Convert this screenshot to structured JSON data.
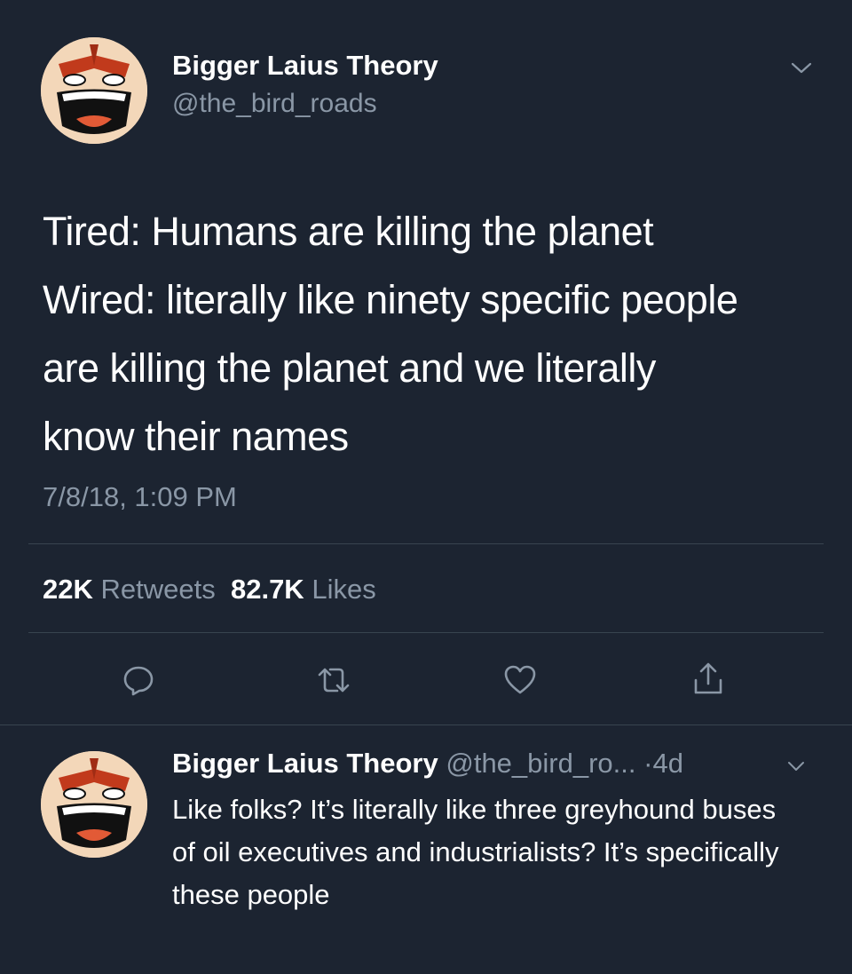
{
  "tweet": {
    "display_name": "Bigger Laius Theory",
    "handle": "@the_bird_roads",
    "lines": [
      "Tired: Humans are killing the planet",
      "Wired: literally like ninety specific people",
      "are killing the planet and we literally",
      "know their names"
    ],
    "timestamp": "7/8/18, 1:09 PM",
    "retweets_count": "22K",
    "retweets_label": "Retweets",
    "likes_count": "82.7K",
    "likes_label": "Likes"
  },
  "reply": {
    "display_name": "Bigger Laius Theory",
    "handle": "@the_bird_ro...",
    "separator": "·",
    "age": "4d",
    "text": "Like folks? It’s literally like three greyhound buses of oil executives and industrialists? It’s specifically these people"
  },
  "icons": {
    "chevron": "chevron-down-icon",
    "reply": "reply-icon",
    "retweet": "retweet-icon",
    "like": "heart-icon",
    "share": "share-icon"
  },
  "colors": {
    "background": "#1c2431",
    "text_primary": "#ffffff",
    "text_secondary": "#8a97a6",
    "divider": "#38444f"
  }
}
